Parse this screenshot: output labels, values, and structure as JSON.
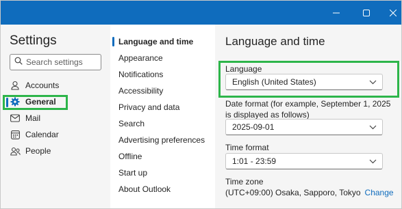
{
  "titlebar": {
    "minimize_icon": "minimize-icon",
    "maximize_icon": "maximize-icon",
    "close_icon": "close-icon",
    "color": "#0f6cbd"
  },
  "sidebar": {
    "title": "Settings",
    "search": {
      "placeholder": "Search settings",
      "value": ""
    },
    "items": [
      {
        "label": "Accounts",
        "icon": "person-icon"
      },
      {
        "label": "General",
        "icon": "gear-icon",
        "selected": true
      },
      {
        "label": "Mail",
        "icon": "mail-icon"
      },
      {
        "label": "Calendar",
        "icon": "calendar-icon"
      },
      {
        "label": "People",
        "icon": "people-icon"
      }
    ]
  },
  "submenu": {
    "items": [
      {
        "label": "Language and time",
        "selected": true
      },
      {
        "label": "Appearance"
      },
      {
        "label": "Notifications"
      },
      {
        "label": "Accessibility"
      },
      {
        "label": "Privacy and data"
      },
      {
        "label": "Search"
      },
      {
        "label": "Advertising preferences"
      },
      {
        "label": "Offline"
      },
      {
        "label": "Start up"
      },
      {
        "label": "About Outlook"
      }
    ]
  },
  "main": {
    "title": "Language and time",
    "language": {
      "label": "Language",
      "value": "English (United States)"
    },
    "date_format": {
      "label": "Date format (for example, September 1, 2025 is displayed as follows)",
      "value": "2025-09-01"
    },
    "time_format": {
      "label": "Time format",
      "value": "1:01 - 23:59"
    },
    "time_zone": {
      "label": "Time zone",
      "value": "(UTC+09:00) Osaka, Sapporo, Tokyo",
      "change_label": "Change"
    }
  },
  "colors": {
    "accent": "#0f6cbd",
    "highlight": "#2db54a",
    "panel": "#f5f5f5"
  }
}
